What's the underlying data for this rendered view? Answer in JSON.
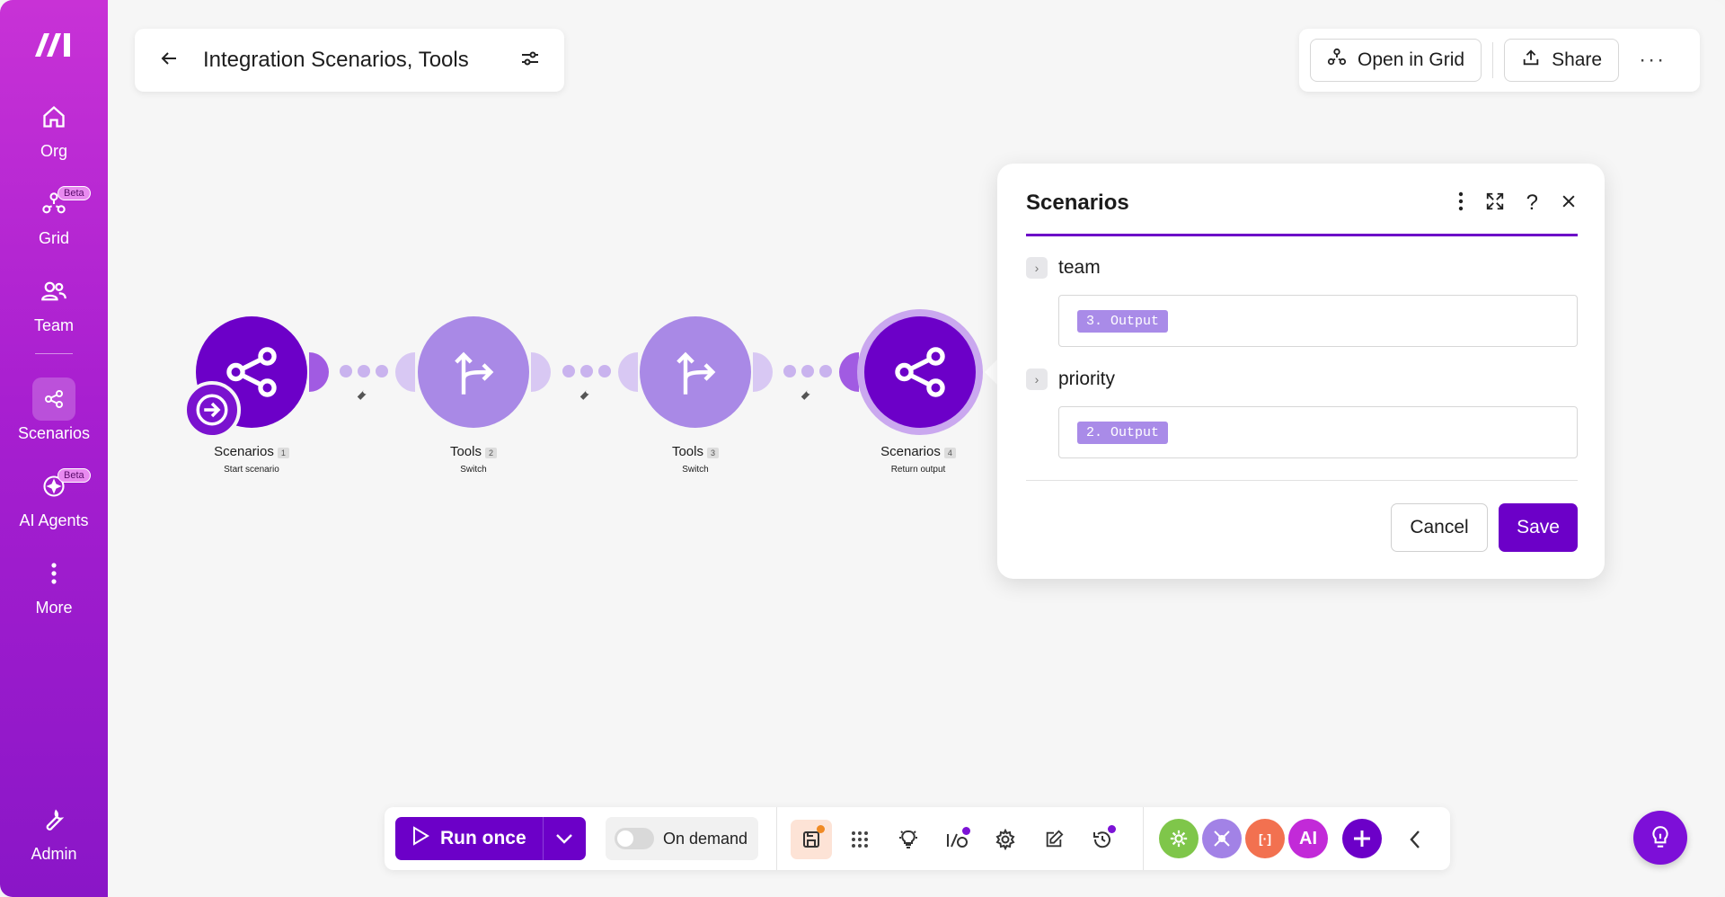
{
  "sidebar": {
    "items": [
      {
        "label": "Org",
        "icon": "home-icon"
      },
      {
        "label": "Grid",
        "icon": "grid-icon",
        "badge": "Beta"
      },
      {
        "label": "Team",
        "icon": "team-icon"
      },
      {
        "label": "Scenarios",
        "icon": "scenarios-icon",
        "active": true
      },
      {
        "label": "AI Agents",
        "icon": "ai-agents-icon",
        "badge": "Beta"
      },
      {
        "label": "More",
        "icon": "more-icon"
      },
      {
        "label": "Admin",
        "icon": "wrench-icon"
      }
    ]
  },
  "header": {
    "title": "Integration Scenarios, Tools"
  },
  "actions": {
    "open_grid": "Open in Grid",
    "share": "Share"
  },
  "flow": {
    "nodes": [
      {
        "name": "Scenarios",
        "num": "1",
        "sub": "Start scenario"
      },
      {
        "name": "Tools",
        "num": "2",
        "sub": "Switch"
      },
      {
        "name": "Tools",
        "num": "3",
        "sub": "Switch"
      },
      {
        "name": "Scenarios",
        "num": "4",
        "sub": "Return output"
      }
    ]
  },
  "panel": {
    "title": "Scenarios",
    "fields": [
      {
        "label": "team",
        "value": "3. Output"
      },
      {
        "label": "priority",
        "value": "2. Output"
      }
    ],
    "cancel": "Cancel",
    "save": "Save"
  },
  "toolbar": {
    "run_once": "Run once",
    "on_demand": "On demand",
    "ai_label": "AI",
    "code_label": "[·]"
  },
  "colors": {
    "brand": "#6c00c8",
    "brand_light": "#a989e6",
    "sidebar_top": "#c832d6",
    "sidebar_bottom": "#8a16c7"
  }
}
